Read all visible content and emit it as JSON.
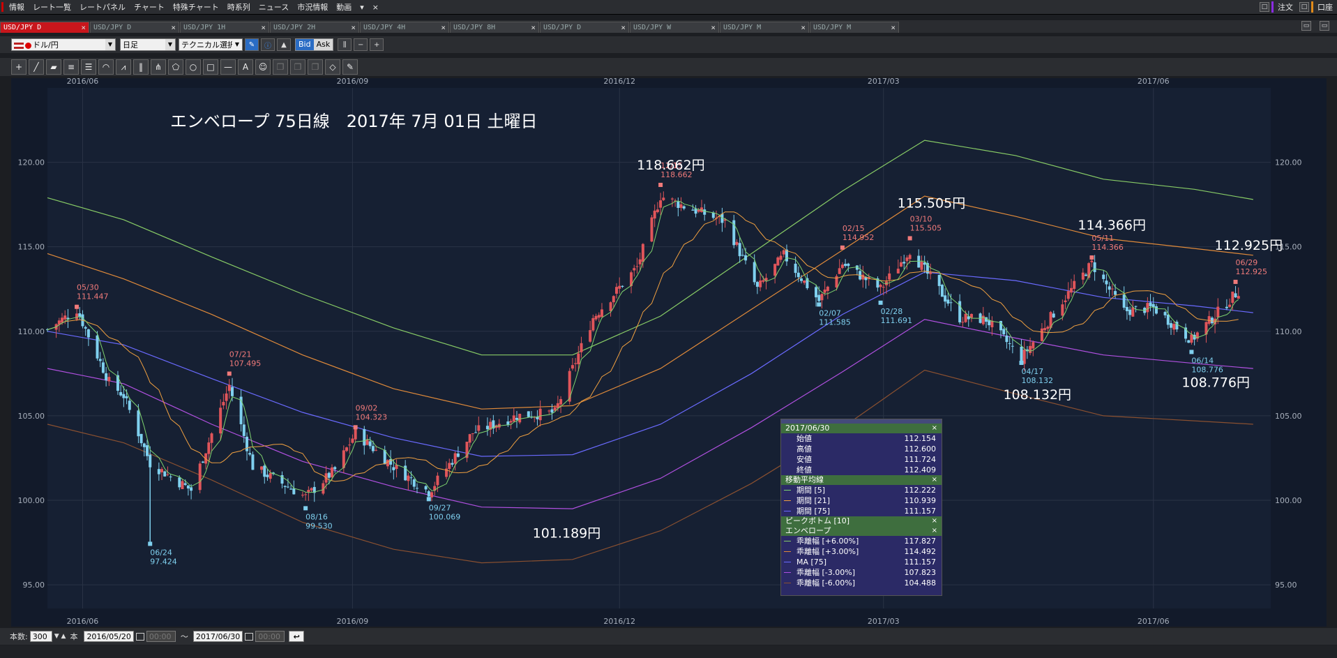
{
  "menubar": {
    "items": [
      "情報",
      "レート一覧",
      "レートパネル",
      "チャート",
      "特殊チャート",
      "時系列",
      "ニュース",
      "市況情報",
      "動画"
    ],
    "dropdown": "▾",
    "close": "×",
    "right": {
      "order": "注文",
      "account": "口座"
    }
  },
  "tabs": [
    {
      "label": "USD/JPY D",
      "active": true
    },
    {
      "label": "USD/JPY D",
      "active": false
    },
    {
      "label": "USD/JPY 1H",
      "active": false
    },
    {
      "label": "USD/JPY 2H",
      "active": false
    },
    {
      "label": "USD/JPY 4H",
      "active": false
    },
    {
      "label": "USD/JPY 8H",
      "active": false
    },
    {
      "label": "USD/JPY D",
      "active": false
    },
    {
      "label": "USD/JPY W",
      "active": false
    },
    {
      "label": "USD/JPY M",
      "active": false
    },
    {
      "label": "USD/JPY M",
      "active": false
    }
  ],
  "tab_close": "×",
  "toolbar": {
    "pair": "ドル/円",
    "timeframe": "日足",
    "technical": "テクニカル選択",
    "bid": "Bid",
    "ask": "Ask"
  },
  "statusbar": {
    "count_label": "本数:",
    "count_value": "300",
    "count_unit": "本",
    "from_date": "2016/05/20",
    "from_time": "00:00",
    "tilde": "〜",
    "to_date": "2017/06/30",
    "to_time": "00:00"
  },
  "chart_title": "エンベロープ 75日線　2017年 7月 01日 土曜日",
  "datawin": {
    "date": "2017/06/30",
    "ohlc": [
      {
        "label": "始値",
        "value": "112.154"
      },
      {
        "label": "高値",
        "value": "112.600"
      },
      {
        "label": "安値",
        "value": "111.724"
      },
      {
        "label": "終値",
        "value": "112.409"
      }
    ],
    "ma_head": "移動平均線",
    "ma": [
      {
        "label": "期間 [5]",
        "value": "112.222",
        "color": "#7fd46f"
      },
      {
        "label": "期間 [21]",
        "value": "110.939",
        "color": "#f0a040"
      },
      {
        "label": "期間 [75]",
        "value": "111.157",
        "color": "#6a6aff"
      }
    ],
    "peak_head": "ピークボトム [10]",
    "env_head": "エンベロープ",
    "env": [
      {
        "label": "乖離幅 [+6.00%]",
        "value": "117.827",
        "color": "#88cc66"
      },
      {
        "label": "乖離幅 [+3.00%]",
        "value": "114.492",
        "color": "#e08a3a"
      },
      {
        "label": "MA [75]",
        "value": "111.157",
        "color": "#6a6aff"
      },
      {
        "label": "乖離幅 [-3.00%]",
        "value": "107.823",
        "color": "#b050e0"
      },
      {
        "label": "乖離幅 [-6.00%]",
        "value": "104.488",
        "color": "#8a5030"
      }
    ],
    "close_x": "×"
  },
  "chart_data": {
    "type": "candlestick",
    "y_ticks": [
      "120.00",
      "115.00",
      "110.00",
      "105.00",
      "100.00",
      "95.00"
    ],
    "y_tick_values": [
      120,
      115,
      110,
      105,
      100,
      95
    ],
    "ylim": [
      93.6,
      124.4
    ],
    "x_ticks": [
      "2016/06",
      "2016/09",
      "2016/12",
      "2017/03",
      "2017/06"
    ],
    "x_tick_dates": [
      "2016-06-01",
      "2016-09-01",
      "2016-12-01",
      "2017-03-01",
      "2017-06-01"
    ],
    "x_range": [
      "2016-05-20",
      "2017-07-11"
    ],
    "colors": {
      "up": "#e0555a",
      "down": "#7fd0ef",
      "grid": "#2a3346"
    },
    "close_series": [
      {
        "date": "2016-05-20",
        "value": 110.1
      },
      {
        "date": "2016-05-30",
        "value": 111.3
      },
      {
        "date": "2016-06-10",
        "value": 107.0
      },
      {
        "date": "2016-06-15",
        "value": 106.2
      },
      {
        "date": "2016-06-24",
        "value": 102.2
      },
      {
        "date": "2016-07-08",
        "value": 100.6
      },
      {
        "date": "2016-07-21",
        "value": 106.8
      },
      {
        "date": "2016-07-29",
        "value": 102.0
      },
      {
        "date": "2016-08-16",
        "value": 100.2
      },
      {
        "date": "2016-08-26",
        "value": 101.8
      },
      {
        "date": "2016-09-02",
        "value": 104.0
      },
      {
        "date": "2016-09-15",
        "value": 102.0
      },
      {
        "date": "2016-09-27",
        "value": 100.5
      },
      {
        "date": "2016-10-12",
        "value": 104.0
      },
      {
        "date": "2016-10-27",
        "value": 105.0
      },
      {
        "date": "2016-11-09",
        "value": 105.2
      },
      {
        "date": "2016-11-22",
        "value": 110.8
      },
      {
        "date": "2016-12-07",
        "value": 113.8
      },
      {
        "date": "2016-12-15",
        "value": 118.0
      },
      {
        "date": "2016-12-23",
        "value": 117.4
      },
      {
        "date": "2017-01-06",
        "value": 116.5
      },
      {
        "date": "2017-01-17",
        "value": 112.5
      },
      {
        "date": "2017-01-26",
        "value": 114.5
      },
      {
        "date": "2017-02-07",
        "value": 111.8
      },
      {
        "date": "2017-02-15",
        "value": 114.0
      },
      {
        "date": "2017-02-28",
        "value": 112.5
      },
      {
        "date": "2017-03-10",
        "value": 114.8
      },
      {
        "date": "2017-03-27",
        "value": 110.8
      },
      {
        "date": "2017-04-05",
        "value": 110.7
      },
      {
        "date": "2017-04-17",
        "value": 108.4
      },
      {
        "date": "2017-05-01",
        "value": 111.8
      },
      {
        "date": "2017-05-11",
        "value": 114.0
      },
      {
        "date": "2017-05-22",
        "value": 111.2
      },
      {
        "date": "2017-06-01",
        "value": 111.4
      },
      {
        "date": "2017-06-14",
        "value": 109.5
      },
      {
        "date": "2017-06-30",
        "value": 112.4
      }
    ],
    "envelope": {
      "ma75": [
        [
          "2016-05-20",
          110.0
        ],
        [
          "2016-06-15",
          109.2
        ],
        [
          "2016-07-15",
          107.2
        ],
        [
          "2016-08-15",
          105.2
        ],
        [
          "2016-09-15",
          103.7
        ],
        [
          "2016-10-15",
          102.6
        ],
        [
          "2016-11-15",
          102.7
        ],
        [
          "2016-12-15",
          104.5
        ],
        [
          "2017-01-15",
          107.5
        ],
        [
          "2017-02-15",
          111.0
        ],
        [
          "2017-03-15",
          113.5
        ],
        [
          "2017-04-15",
          113.0
        ],
        [
          "2017-05-15",
          112.0
        ],
        [
          "2017-06-15",
          111.5
        ],
        [
          "2017-07-05",
          111.1
        ]
      ],
      "plus6": [
        [
          "2016-05-20",
          117.9
        ],
        [
          "2016-06-15",
          116.6
        ],
        [
          "2016-07-15",
          114.4
        ],
        [
          "2016-08-15",
          112.2
        ],
        [
          "2016-09-15",
          110.2
        ],
        [
          "2016-10-15",
          108.6
        ],
        [
          "2016-11-15",
          108.6
        ],
        [
          "2016-12-15",
          110.9
        ],
        [
          "2017-01-15",
          114.6
        ],
        [
          "2017-02-15",
          118.3
        ],
        [
          "2017-03-15",
          121.3
        ],
        [
          "2017-04-15",
          120.4
        ],
        [
          "2017-05-15",
          119.0
        ],
        [
          "2017-06-15",
          118.4
        ],
        [
          "2017-07-05",
          117.8
        ]
      ],
      "plus3": [
        [
          "2016-05-20",
          114.6
        ],
        [
          "2016-06-15",
          113.1
        ],
        [
          "2016-07-15",
          111.0
        ],
        [
          "2016-08-15",
          108.6
        ],
        [
          "2016-09-15",
          106.6
        ],
        [
          "2016-10-15",
          105.4
        ],
        [
          "2016-11-15",
          105.6
        ],
        [
          "2016-12-15",
          107.8
        ],
        [
          "2017-01-15",
          111.3
        ],
        [
          "2017-02-15",
          114.8
        ],
        [
          "2017-03-15",
          118.0
        ],
        [
          "2017-04-15",
          116.8
        ],
        [
          "2017-05-15",
          115.5
        ],
        [
          "2017-06-15",
          114.9
        ],
        [
          "2017-07-05",
          114.5
        ]
      ],
      "minus3": [
        [
          "2016-05-20",
          107.8
        ],
        [
          "2016-06-15",
          106.9
        ],
        [
          "2016-07-15",
          104.5
        ],
        [
          "2016-08-15",
          102.3
        ],
        [
          "2016-09-15",
          100.8
        ],
        [
          "2016-10-15",
          99.6
        ],
        [
          "2016-11-15",
          99.5
        ],
        [
          "2016-12-15",
          101.3
        ],
        [
          "2017-01-15",
          104.3
        ],
        [
          "2017-02-15",
          107.6
        ],
        [
          "2017-03-15",
          110.7
        ],
        [
          "2017-04-15",
          109.6
        ],
        [
          "2017-05-15",
          108.6
        ],
        [
          "2017-06-15",
          108.1
        ],
        [
          "2017-07-05",
          107.8
        ]
      ],
      "minus6": [
        [
          "2016-05-20",
          104.5
        ],
        [
          "2016-06-15",
          103.4
        ],
        [
          "2016-07-15",
          101.2
        ],
        [
          "2016-08-15",
          98.7
        ],
        [
          "2016-09-15",
          97.1
        ],
        [
          "2016-10-15",
          96.3
        ],
        [
          "2016-11-15",
          96.5
        ],
        [
          "2016-12-15",
          98.2
        ],
        [
          "2017-01-15",
          101.0
        ],
        [
          "2017-02-15",
          104.3
        ],
        [
          "2017-03-15",
          107.7
        ],
        [
          "2017-04-15",
          106.3
        ],
        [
          "2017-05-15",
          105.0
        ],
        [
          "2017-06-15",
          104.7
        ],
        [
          "2017-07-05",
          104.5
        ]
      ]
    },
    "peaks": [
      {
        "date": "2016-05-30",
        "value": 111.447,
        "label_date": "05/30",
        "label_value": "111.447",
        "kind": "high"
      },
      {
        "date": "2016-06-24",
        "value": 97.424,
        "label_date": "06/24",
        "label_value": "97.424",
        "kind": "low"
      },
      {
        "date": "2016-07-21",
        "value": 107.495,
        "label_date": "07/21",
        "label_value": "107.495",
        "kind": "high"
      },
      {
        "date": "2016-08-16",
        "value": 99.53,
        "label_date": "08/16",
        "label_value": "99.530",
        "kind": "low"
      },
      {
        "date": "2016-09-02",
        "value": 104.323,
        "label_date": "09/02",
        "label_value": "104.323",
        "kind": "high"
      },
      {
        "date": "2016-09-27",
        "value": 100.069,
        "label_date": "09/27",
        "label_value": "100.069",
        "kind": "low"
      },
      {
        "date": "2016-12-15",
        "value": 118.662,
        "label_date": "12/15",
        "label_value": "118.662",
        "kind": "high"
      },
      {
        "date": "2017-02-07",
        "value": 111.585,
        "label_date": "02/07",
        "label_value": "111.585",
        "kind": "low"
      },
      {
        "date": "2017-02-15",
        "value": 114.952,
        "label_date": "02/15",
        "label_value": "114.952",
        "kind": "high"
      },
      {
        "date": "2017-02-28",
        "value": 111.691,
        "label_date": "02/28",
        "label_value": "111.691",
        "kind": "low"
      },
      {
        "date": "2017-03-10",
        "value": 115.505,
        "label_date": "03/10",
        "label_value": "115.505",
        "kind": "high"
      },
      {
        "date": "2017-04-17",
        "value": 108.132,
        "label_date": "04/17",
        "label_value": "108.132",
        "kind": "low"
      },
      {
        "date": "2017-05-11",
        "value": 114.366,
        "label_date": "05/11",
        "label_value": "114.366",
        "kind": "high"
      },
      {
        "date": "2017-06-14",
        "value": 108.776,
        "label_date": "06/14",
        "label_value": "108.776",
        "kind": "low"
      },
      {
        "date": "2017-06-29",
        "value": 112.925,
        "label_date": "06/29",
        "label_value": "112.925",
        "kind": "high"
      }
    ],
    "callouts": [
      {
        "text": "118.662円",
        "date": "2016-12-15",
        "value": 118.662
      },
      {
        "text": "101.189円",
        "date": "2016-11-09",
        "value": 101.189
      },
      {
        "text": "115.505円",
        "date": "2017-03-10",
        "value": 115.505
      },
      {
        "text": "114.366円",
        "date": "2017-05-11",
        "value": 114.366
      },
      {
        "text": "108.132円",
        "date": "2017-04-17",
        "value": 108.132
      },
      {
        "text": "108.776円",
        "date": "2017-06-14",
        "value": 108.776
      },
      {
        "text": "112.925円",
        "date": "2017-06-29",
        "value": 112.925
      }
    ]
  }
}
